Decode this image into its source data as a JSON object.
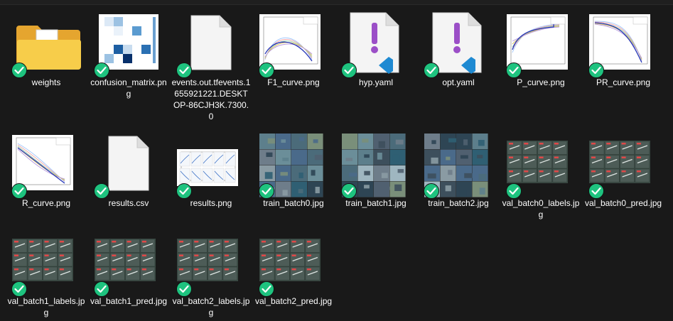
{
  "files": [
    {
      "name": "weights",
      "kind": "folder"
    },
    {
      "name": "confusion_matrix.png",
      "kind": "confusion"
    },
    {
      "name": "events.out.tfevents.1655921221.DESKTOP-86CJH3K.7300.0",
      "kind": "doc"
    },
    {
      "name": "F1_curve.png",
      "kind": "f1"
    },
    {
      "name": "hyp.yaml",
      "kind": "yaml"
    },
    {
      "name": "opt.yaml",
      "kind": "yaml"
    },
    {
      "name": "P_curve.png",
      "kind": "pcurve"
    },
    {
      "name": "PR_curve.png",
      "kind": "prcurve"
    },
    {
      "name": "R_curve.png",
      "kind": "rcurve"
    },
    {
      "name": "results.csv",
      "kind": "doc"
    },
    {
      "name": "results.png",
      "kind": "results"
    },
    {
      "name": "train_batch0.jpg",
      "kind": "train"
    },
    {
      "name": "train_batch1.jpg",
      "kind": "train"
    },
    {
      "name": "train_batch2.jpg",
      "kind": "train"
    },
    {
      "name": "val_batch0_labels.jpg",
      "kind": "val"
    },
    {
      "name": "val_batch0_pred.jpg",
      "kind": "val"
    },
    {
      "name": "val_batch1_labels.jpg",
      "kind": "val"
    },
    {
      "name": "val_batch1_pred.jpg",
      "kind": "val"
    },
    {
      "name": "val_batch2_labels.jpg",
      "kind": "val"
    },
    {
      "name": "val_batch2_pred.jpg",
      "kind": "val"
    }
  ],
  "status_icon": "sync-check-icon",
  "colors": {
    "background": "#191919",
    "check": "#1ec37f",
    "folder": "#f5c542",
    "vscode_blue": "#1f8ad2",
    "yaml_mark": "#9b4fc7"
  }
}
